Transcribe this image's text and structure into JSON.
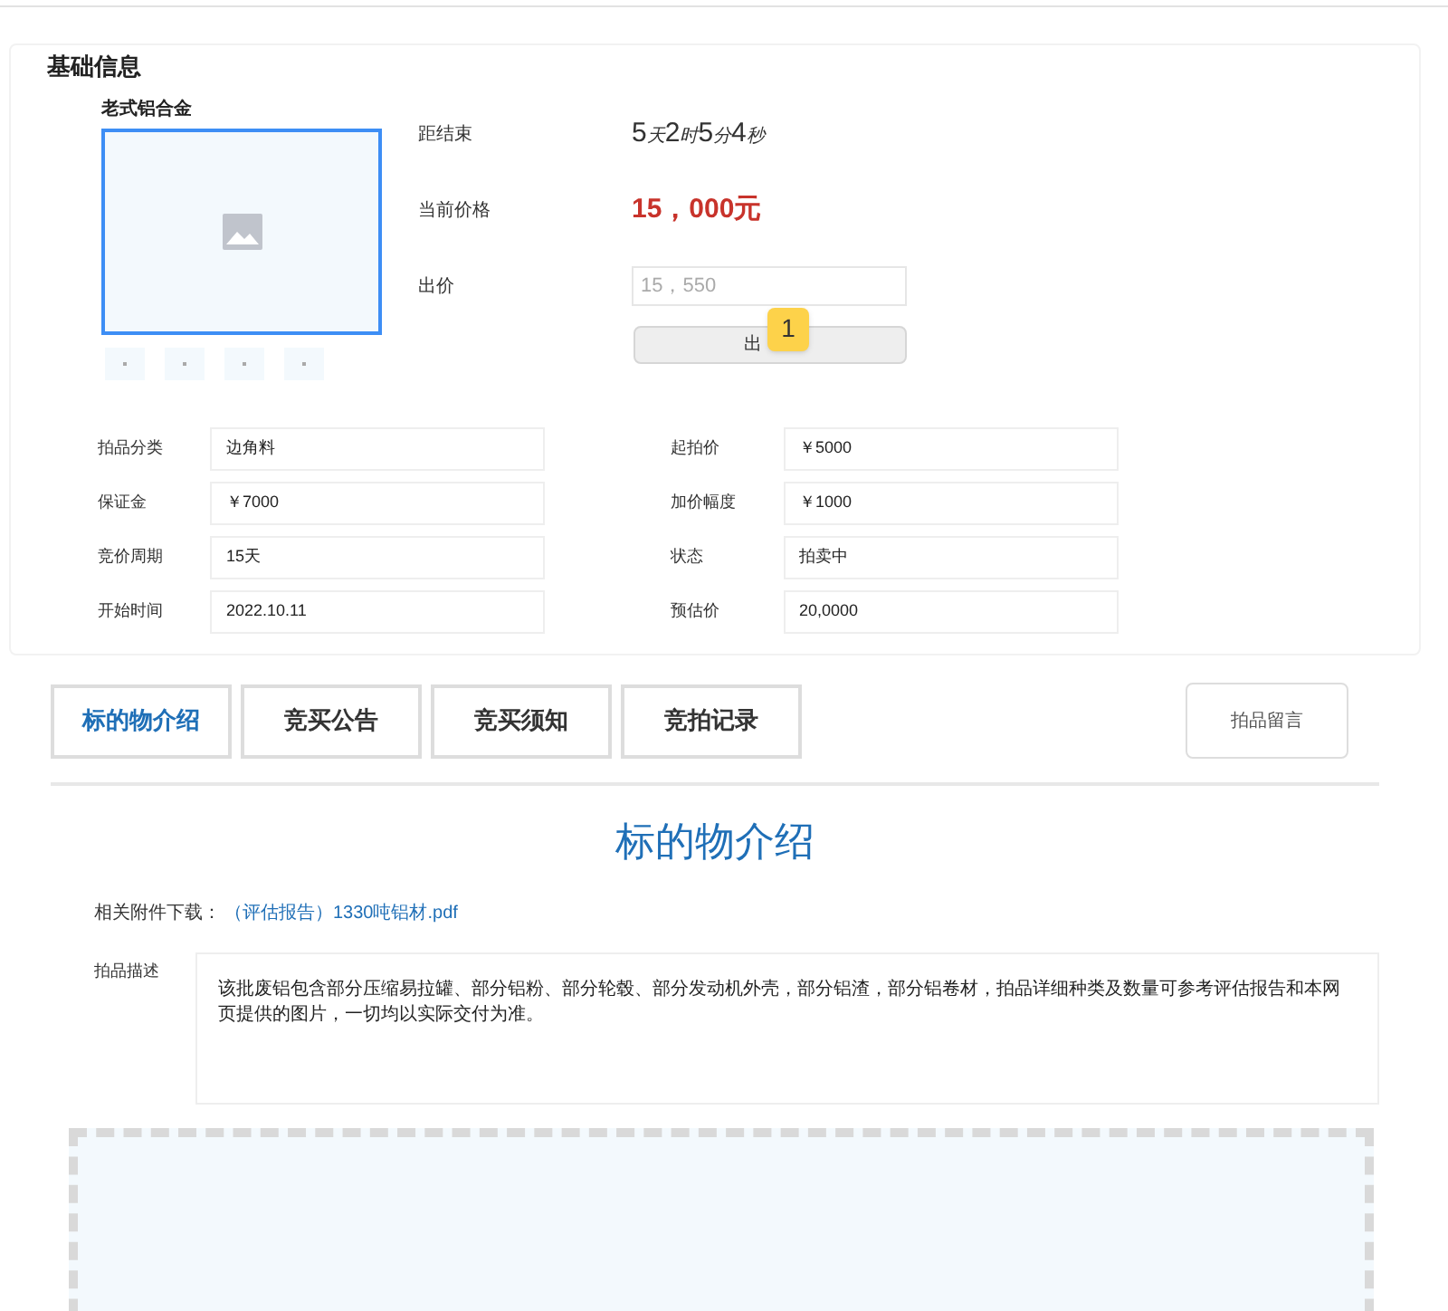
{
  "section_title": "基础信息",
  "product": {
    "name": "老式铝合金"
  },
  "bid_panel": {
    "rows": [
      {
        "label": "距结束",
        "kind": "countdown",
        "parts": [
          {
            "num": "5",
            "unit": "天"
          },
          {
            "num": "2",
            "unit": "时"
          },
          {
            "num": "5",
            "unit": "分"
          },
          {
            "num": "4",
            "unit": "秒"
          }
        ]
      },
      {
        "label": "当前价格",
        "kind": "price",
        "value": "15，000元"
      },
      {
        "label": "出价",
        "kind": "input",
        "placeholder": "15，550"
      }
    ],
    "button": "出",
    "badge": "1"
  },
  "details": [
    {
      "label": "拍品分类",
      "value": "边角料"
    },
    {
      "label": "起拍价",
      "value": "￥5000"
    },
    {
      "label": "保证金",
      "value": "￥7000"
    },
    {
      "label": "加价幅度",
      "value": "￥1000"
    },
    {
      "label": "竞价周期",
      "value": "15天"
    },
    {
      "label": "状态",
      "value": "拍卖中"
    },
    {
      "label": "开始时间",
      "value": "2022.10.11"
    },
    {
      "label": "预估价",
      "value": "20,0000"
    }
  ],
  "tabs": [
    {
      "label": "标的物介绍",
      "selected": true
    },
    {
      "label": "竞买公告",
      "selected": false
    },
    {
      "label": "竞买须知",
      "selected": false
    },
    {
      "label": "竞拍记录",
      "selected": false
    }
  ],
  "message_button": "拍品留言",
  "intro": {
    "title": "标的物介绍",
    "attachment_label": "相关附件下载：",
    "attachment_link": "（评估报告）1330吨铝材.pdf",
    "description_label": "拍品描述",
    "description": "该批废铝包含部分压缩易拉罐、部分铝粉、部分轮毂、部分发动机外壳，部分铝渣，部分铝卷材，拍品详细种类及数量可参考评估报告和本网页提供的图片，一切均以实际交付为准。"
  }
}
